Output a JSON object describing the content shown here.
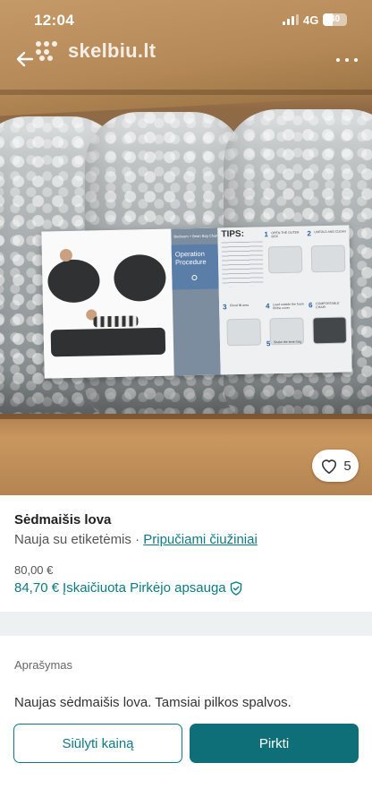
{
  "status_bar": {
    "time": "12:04",
    "network": "4G",
    "battery": "40"
  },
  "header": {
    "logo_text": "skelbiu.lt",
    "back_icon": "arrow-left-icon",
    "more_icon": "more-dots-icon"
  },
  "photo": {
    "card_tips_title": "TIPS:",
    "card_procedure_label": "Operation Procedure",
    "card_procedure_header": "Bedroom + Bean Bag Chair",
    "card_steps": [
      {
        "n": "1",
        "text": "OPEN THE OUTER BOX"
      },
      {
        "n": "2",
        "text": "UNFOLD AND CLEAN"
      },
      {
        "n": "3",
        "text": "Flood fill area"
      },
      {
        "n": "4",
        "text": "Lead outside the foam fill the cover"
      },
      {
        "n": "5",
        "text": "Shake the bean bag"
      },
      {
        "n": "6",
        "text": "COMFORTABLE CHAIR"
      }
    ]
  },
  "favorite": {
    "icon": "heart-outline-icon",
    "count": "5"
  },
  "listing": {
    "title": "Sėdmaišis lova",
    "condition": "Nauja su etiketėmis",
    "separator": "·",
    "category": "Pripučiami čiužiniai",
    "price": "80,00 €",
    "price_with_protection": "84,70 €",
    "protection_label": "Įskaičiuota Pirkėjo apsauga",
    "protection_icon": "shield-check-icon"
  },
  "description": {
    "label": "Aprašymas",
    "text": "Naujas sėdmaišis lova. Tamsiai pilkos spalvos."
  },
  "actions": {
    "offer_label": "Siūlyti kainą",
    "buy_label": "Pirkti"
  },
  "colors": {
    "accent": "#0d7a84",
    "buy_button": "#0e6f78"
  }
}
